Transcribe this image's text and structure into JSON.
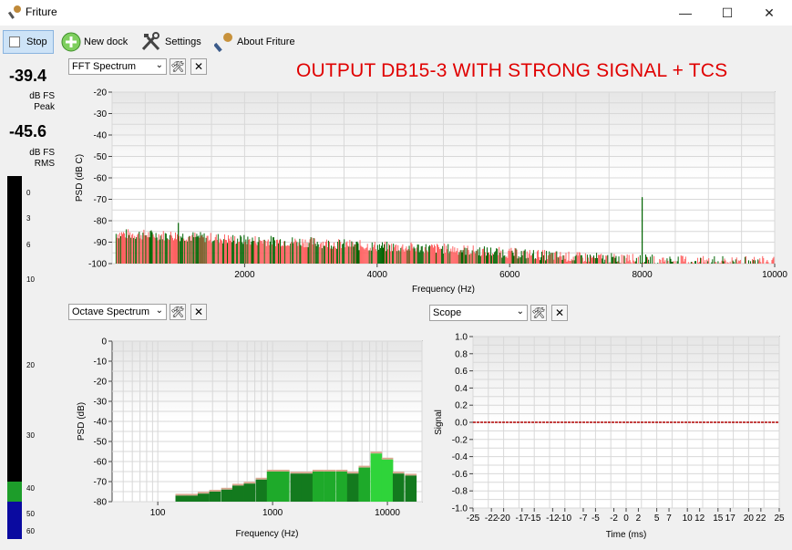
{
  "window": {
    "title": "Friture",
    "minimize_glyph": "—",
    "maximize_glyph": "☐",
    "close_glyph": "✕"
  },
  "toolbar": {
    "stop_label": "Stop",
    "new_dock_label": "New dock",
    "settings_label": "Settings",
    "about_label": "About Friture"
  },
  "meters": {
    "peak_value": "-39.4",
    "peak_unit": "dB FS",
    "peak_label": "Peak",
    "rms_value": "-45.6",
    "rms_unit": "dB FS",
    "rms_label": "RMS",
    "scale": [
      "0",
      "3",
      "6",
      "10",
      "20",
      "30",
      "40",
      "50",
      "60"
    ]
  },
  "annotation": "OUTPUT DB15-3 WITH STRONG SIGNAL + TCS",
  "colors": {
    "fft_red": "#ff6060",
    "fft_green": "#006400",
    "octave_green": "#1e9a28",
    "octave_peak": "#d8a890",
    "scope_line": "#b00000",
    "annotation": "#e00000"
  },
  "fft_dock": {
    "widget": "FFT Spectrum",
    "settings_icon": "tools-icon",
    "close_icon": "close-icon"
  },
  "octave_dock": {
    "widget": "Octave Spectrum",
    "settings_icon": "tools-icon",
    "close_icon": "close-icon"
  },
  "scope_dock": {
    "widget": "Scope",
    "settings_icon": "tools-icon",
    "close_icon": "close-icon"
  },
  "chart_data": [
    {
      "type": "line",
      "name": "fft",
      "xlabel": "Frequency (Hz)",
      "ylabel": "PSD (dB C)",
      "xlim": [
        0,
        10000
      ],
      "ylim": [
        -100,
        -20
      ],
      "xticks": [
        "2000",
        "4000",
        "6000",
        "8000",
        "10000"
      ],
      "yticks": [
        "-20",
        "-30",
        "-40",
        "-50",
        "-60",
        "-70",
        "-80",
        "-90",
        "-100"
      ],
      "envelope": {
        "x": [
          0,
          1000,
          2000,
          3000,
          4000,
          5000,
          6000,
          7000,
          8000,
          9000,
          10000
        ],
        "y": [
          -87,
          -88,
          -90,
          -91,
          -93,
          -94,
          -96,
          -98,
          -99,
          -100,
          -100
        ]
      },
      "peaks": [
        {
          "x": 1000,
          "y": -81
        },
        {
          "x": 8000,
          "y": -69
        }
      ],
      "grid": true
    },
    {
      "type": "bar",
      "name": "octave",
      "xlabel": "Frequency (Hz)",
      "ylabel": "PSD (dB)",
      "xscale": "log",
      "xlim": [
        40,
        20000
      ],
      "ylim": [
        -80,
        0
      ],
      "xticks": [
        "100",
        "1000",
        "10000"
      ],
      "yticks": [
        "0",
        "-10",
        "-20",
        "-30",
        "-40",
        "-50",
        "-60",
        "-70",
        "-80"
      ],
      "centers": [
        160,
        200,
        250,
        315,
        400,
        500,
        630,
        800,
        1000,
        1250,
        1600,
        2000,
        2500,
        3150,
        4000,
        5000,
        6300,
        8000,
        10000,
        12500,
        16000
      ],
      "values": [
        -77,
        -77,
        -76,
        -75,
        -74,
        -72,
        -71,
        -69,
        -65,
        -65,
        -66,
        -66,
        -65,
        -65,
        -65,
        -66,
        -63,
        -56,
        -59,
        -66,
        -67
      ],
      "grid": true
    },
    {
      "type": "line",
      "name": "scope",
      "xlabel": "Time (ms)",
      "ylabel": "Signal",
      "xlim": [
        -25,
        25
      ],
      "ylim": [
        -1.0,
        1.0
      ],
      "xticks": [
        "-25",
        "-22",
        "-20",
        "-17",
        "-15",
        "-12",
        "-10",
        "-7",
        "-5",
        "-2",
        "0",
        "2",
        "5",
        "7",
        "10",
        "12",
        "15",
        "17",
        "20",
        "22",
        "25"
      ],
      "yticks": [
        "1.0",
        "0.8",
        "0.6",
        "0.4",
        "0.2",
        "0.0",
        "-0.2",
        "-0.4",
        "-0.6",
        "-0.8",
        "-1.0"
      ],
      "x": [
        -25,
        25
      ],
      "y": [
        0.0,
        0.0
      ],
      "grid": true
    }
  ]
}
